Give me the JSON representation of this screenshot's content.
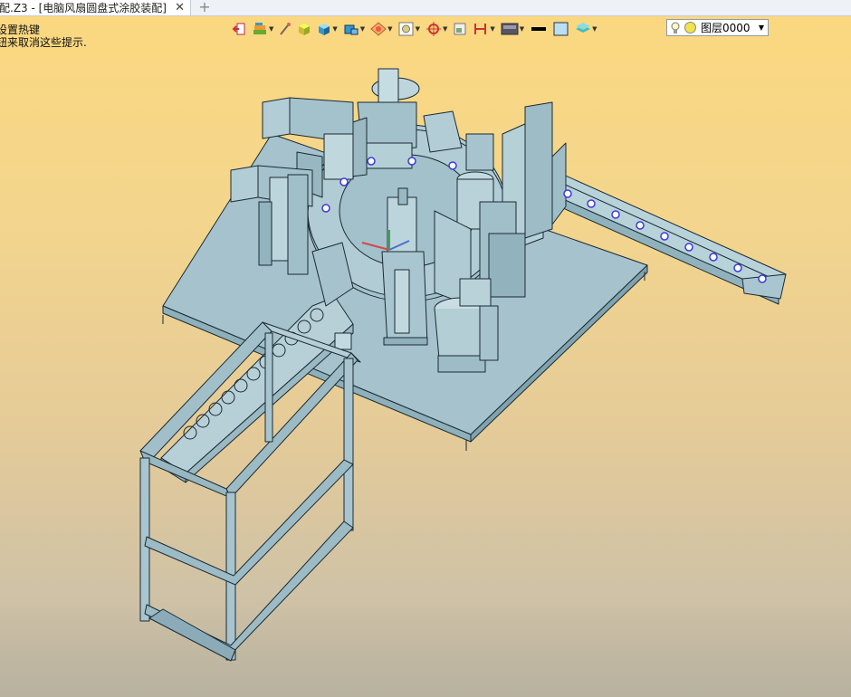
{
  "tab": {
    "label": "配.Z3 - [电脑风扇圆盘式涂胶装配]",
    "close_symbol": "✕",
    "new_symbol": "+"
  },
  "hints": {
    "line1": "设置热键",
    "line2": "钮来取消这些提示."
  },
  "toolbar": {
    "icons": [
      "exit-icon",
      "materials-icon",
      "brush-icon",
      "box-icon",
      "cube-icon",
      "cube-blue-icon",
      "render-icon",
      "view-icon",
      "snap-icon",
      "layout-icon",
      "section-icon",
      "background-icon",
      "line-color-icon",
      "fill-color-icon",
      "layers-icon"
    ]
  },
  "layer": {
    "name": "图层0000",
    "arrow": "▼"
  },
  "colors": {
    "model": "#a9c6d0",
    "edge": "#1a2a33",
    "bg_top": "#fbd880",
    "bg_bottom": "#b7b19f"
  }
}
